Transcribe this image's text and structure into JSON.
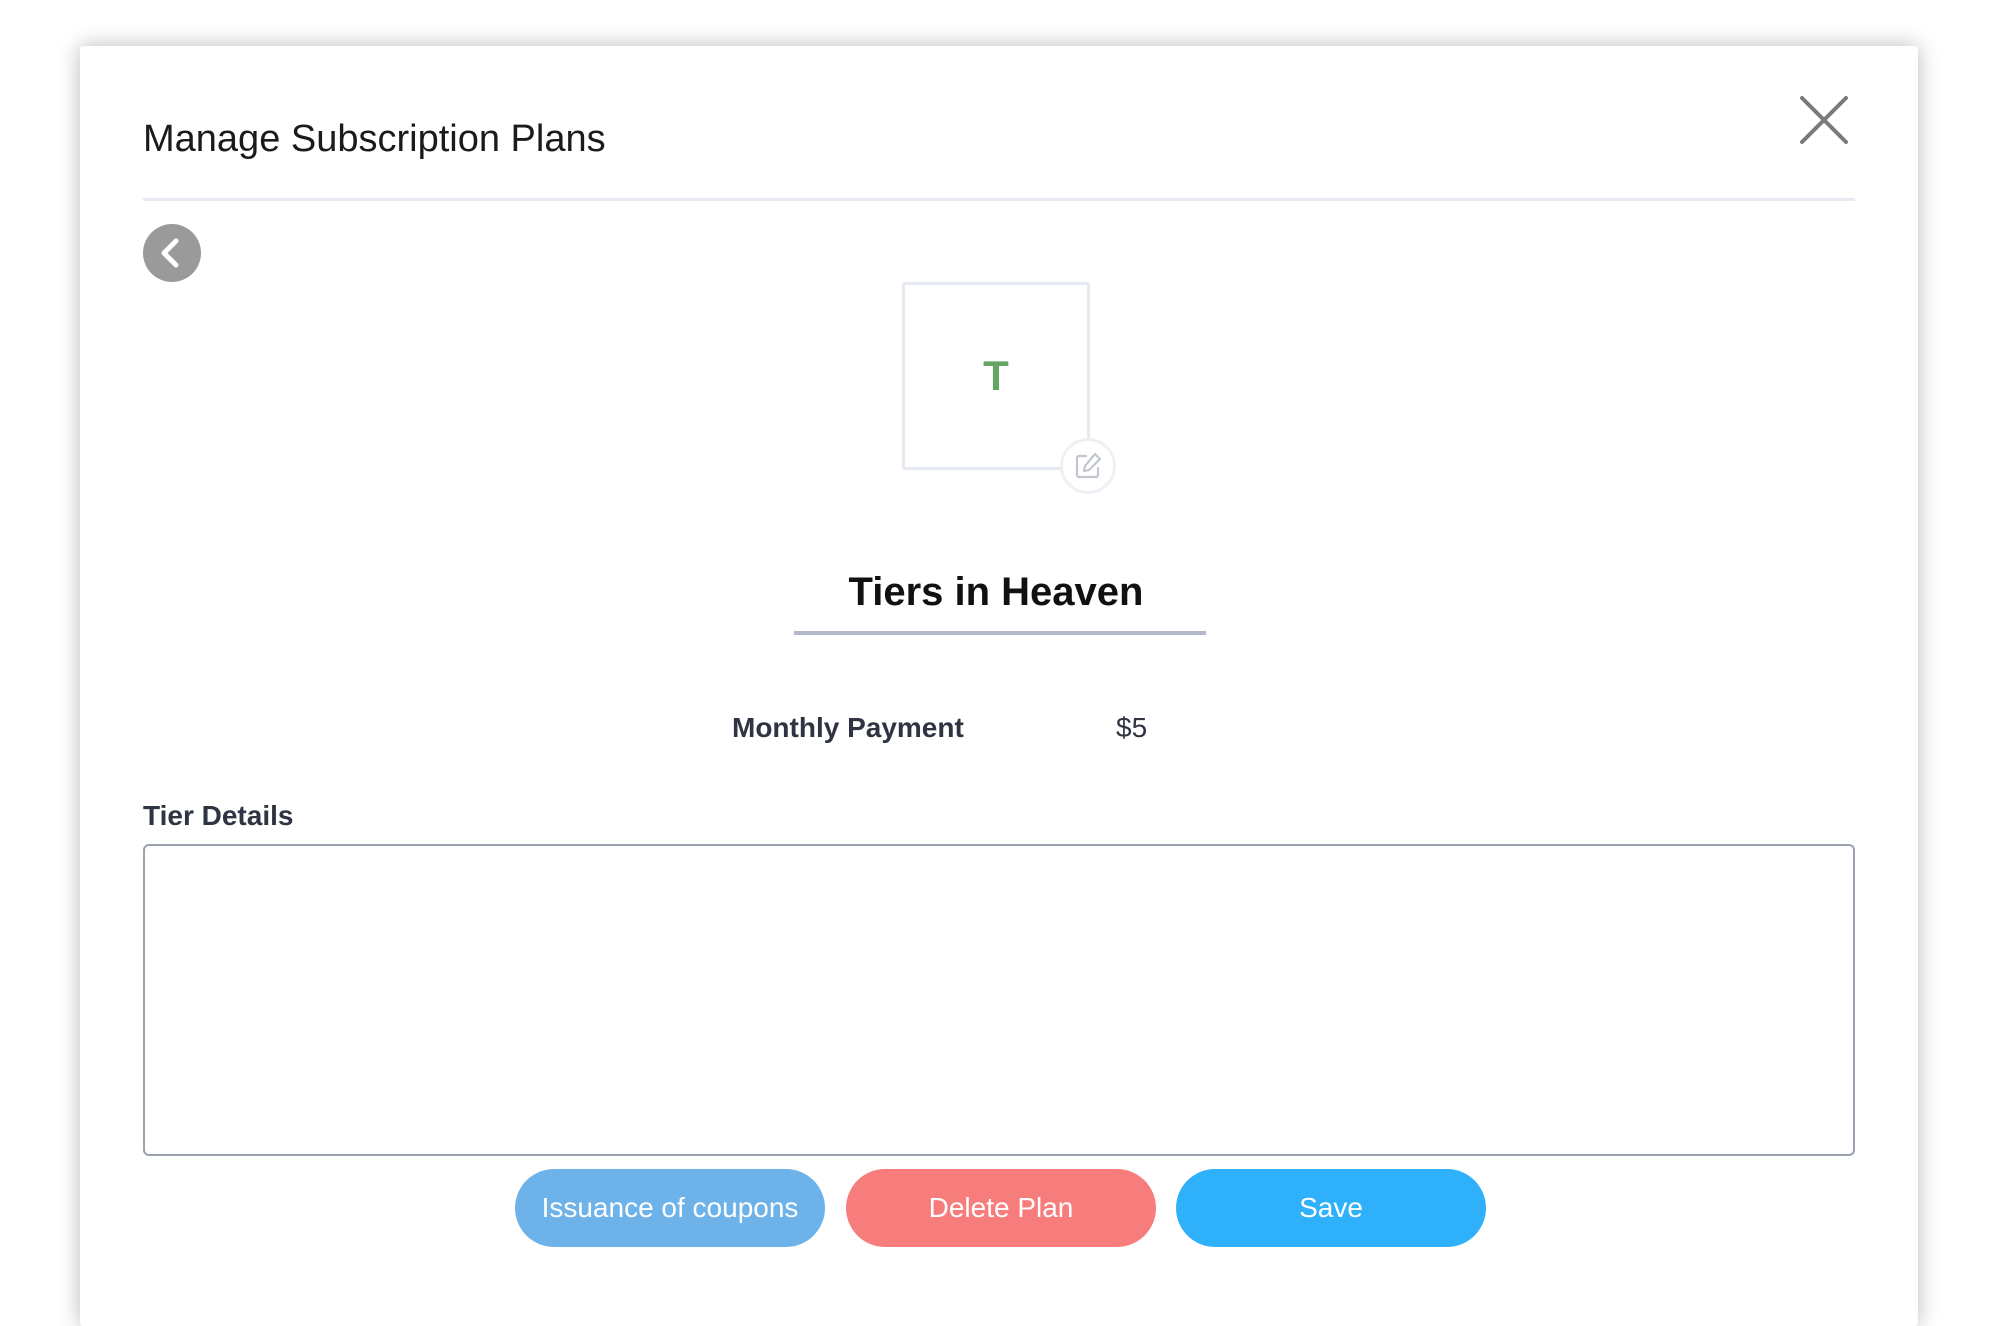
{
  "modal": {
    "title": "Manage Subscription Plans"
  },
  "plan": {
    "avatar_letter": "T",
    "name": "Tiers in Heaven",
    "payment_label": "Monthly Payment",
    "payment_value": "$5"
  },
  "details": {
    "label": "Tier Details",
    "value": ""
  },
  "actions": {
    "coupons_label": "Issuance of coupons",
    "delete_label": "Delete Plan",
    "save_label": "Save"
  },
  "icons": {
    "close": "close-icon",
    "back": "chevron-left-icon",
    "edit": "edit-icon"
  },
  "colors": {
    "avatar_letter": "#63a664",
    "coupons_button": "#6db3ea",
    "delete_button": "#f77c7c",
    "save_button": "#2eb0fb",
    "back_button": "#9a9a9a"
  }
}
